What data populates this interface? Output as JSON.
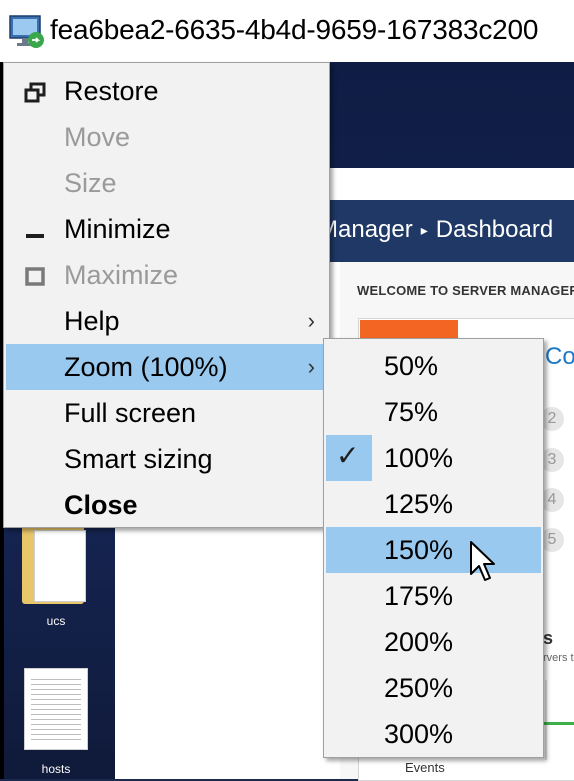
{
  "titlebar": {
    "title": "fea6bea2-6635-4b4d-9659-167383c200"
  },
  "server_manager": {
    "breadcrumb_app": "Manager",
    "breadcrumb_page": "Dashboard",
    "welcome": "WELCOME TO SERVER MANAGER",
    "quick_start_partial": "Co",
    "steps": [
      "2",
      "3",
      "4",
      "5"
    ],
    "section_partial": "s",
    "servers_partial": "rvers t",
    "events_label": "Events"
  },
  "desktop": {
    "icons": [
      {
        "label": "ucs",
        "icon": "folder-icon"
      },
      {
        "label": "hosts",
        "icon": "text-file-icon"
      }
    ]
  },
  "system_menu": {
    "items": [
      {
        "label": "Restore",
        "state": "enabled",
        "icon": "restore-icon"
      },
      {
        "label": "Move",
        "state": "disabled"
      },
      {
        "label": "Size",
        "state": "disabled"
      },
      {
        "label": "Minimize",
        "state": "enabled",
        "icon": "minimize-icon"
      },
      {
        "label": "Maximize",
        "state": "disabled",
        "icon": "maximize-icon"
      },
      {
        "label": "Help",
        "state": "enabled",
        "submenu": true
      },
      {
        "label": "Zoom (100%)",
        "state": "highlighted",
        "submenu": true
      },
      {
        "label": "Full screen",
        "state": "enabled"
      },
      {
        "label": "Smart sizing",
        "state": "enabled"
      },
      {
        "label": "Close",
        "state": "enabled",
        "bold": true
      }
    ],
    "submenu_arrow": "›"
  },
  "zoom_menu": {
    "items": [
      "50%",
      "75%",
      "100%",
      "125%",
      "150%",
      "175%",
      "200%",
      "250%",
      "300%"
    ],
    "checked": "100%",
    "hovered": "150%"
  },
  "colors": {
    "highlight": "#99c9ef",
    "menu_bg": "#f2f2f2",
    "desktop_bg": "#152553",
    "sm_header": "#1f3866",
    "accent_orange": "#f26522",
    "link_blue": "#1b79c7"
  }
}
